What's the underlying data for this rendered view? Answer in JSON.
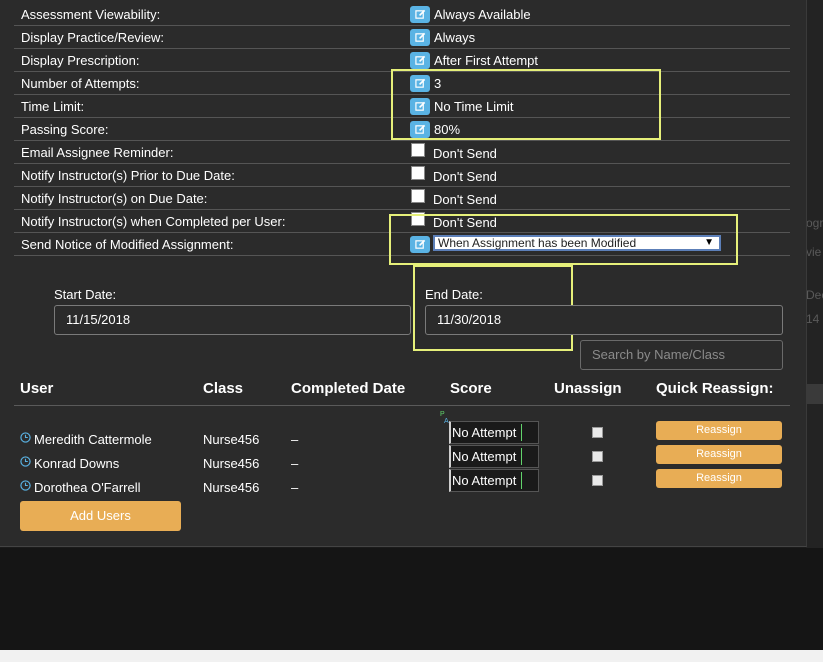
{
  "settings": {
    "assessment_viewability": {
      "label": "Assessment Viewability:",
      "value": "Always Available"
    },
    "display_practice": {
      "label": "Display Practice/Review:",
      "value": "Always"
    },
    "display_prescription": {
      "label": "Display Prescription:",
      "value": "After First Attempt"
    },
    "number_of_attempts": {
      "label": "Number of Attempts:",
      "value": "3"
    },
    "time_limit": {
      "label": "Time Limit:",
      "value": "No Time Limit"
    },
    "passing_score": {
      "label": "Passing Score:",
      "value": "80%"
    },
    "email_reminder": {
      "label": "Email Assignee Reminder:",
      "value": "Don't Send"
    },
    "notify_prior": {
      "label": "Notify Instructor(s) Prior to Due Date:",
      "value": "Don't Send"
    },
    "notify_on_due": {
      "label": "Notify Instructor(s) on Due Date:",
      "value": "Don't Send"
    },
    "notify_completed": {
      "label": "Notify Instructor(s) when Completed per User:",
      "value": "Don't Send"
    },
    "send_notice": {
      "label": "Send Notice of Modified Assignment:",
      "value": "When Assignment has been Modified"
    }
  },
  "dates": {
    "start_label": "Start Date:",
    "start_value": "11/15/2018",
    "end_label": "End Date:",
    "end_value": "11/30/2018"
  },
  "search": {
    "placeholder": "Search by Name/Class"
  },
  "table": {
    "headers": [
      "User",
      "Class",
      "Completed Date",
      "Score",
      "Unassign",
      "Quick Reassign:"
    ],
    "score_marker": {
      "p": "P",
      "a": "A"
    },
    "rows": [
      {
        "name": "Meredith Cattermole",
        "class": "Nurse456",
        "completed": "–",
        "score": "No Attempt",
        "action": "Reassign"
      },
      {
        "name": "Konrad Downs",
        "class": "Nurse456",
        "completed": "–",
        "score": "No Attempt",
        "action": "Reassign"
      },
      {
        "name": "Dorothea O'Farrell",
        "class": "Nurse456",
        "completed": "–",
        "score": "No Attempt",
        "action": "Reassign"
      }
    ]
  },
  "add_users_label": "Add Users",
  "background_fragments": [
    "ogr",
    "vie",
    "Dec",
    "14"
  ],
  "colors": {
    "accent_blue": "#5ab3e4",
    "button_orange": "#e8ad55",
    "highlight": "#e6f07a"
  },
  "icons": {
    "edit": "pencil-square-icon",
    "user_status": "clock-icon"
  }
}
